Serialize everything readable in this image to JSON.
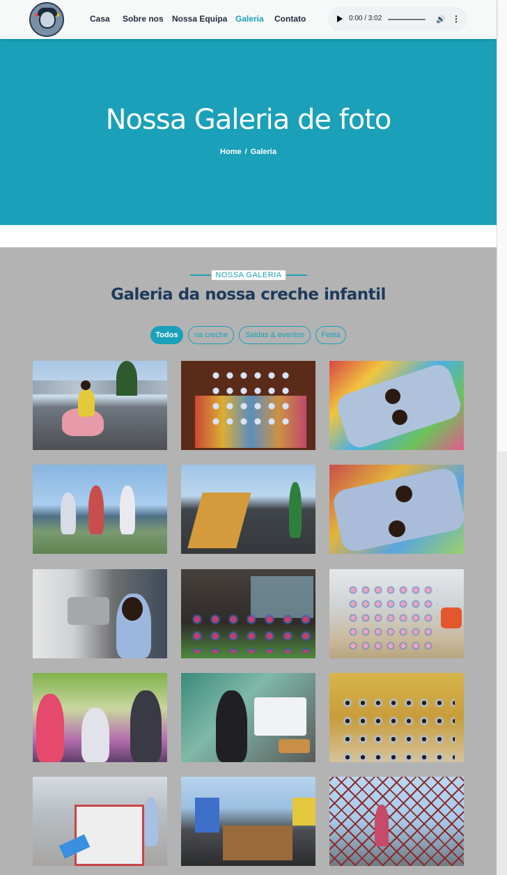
{
  "header": {
    "nav": [
      {
        "label": "Casa",
        "active": false
      },
      {
        "label": "Sobre nos",
        "active": false
      },
      {
        "label": "Nossa Equipa",
        "active": false
      },
      {
        "label": "Galeria",
        "active": true
      },
      {
        "label": "Contato",
        "active": false
      }
    ],
    "audio": {
      "time": "0:00 / 3:02",
      "progress": 0
    }
  },
  "hero": {
    "title": "Nossa Galeria de foto",
    "breadcrumb": {
      "home": "Home",
      "separator": "/",
      "current": "Galeria"
    }
  },
  "gallery": {
    "kicker": "NOSSA GALERIA",
    "title": "Galeria da nossa creche infantil",
    "filters": [
      {
        "label": "Todos",
        "active": true
      },
      {
        "label": "na creche",
        "active": false
      },
      {
        "label": "Saidas & eventos",
        "active": false
      },
      {
        "label": "Festa",
        "active": false
      }
    ]
  },
  "colors": {
    "accent": "#1aa0b8",
    "header_bg": "#f7f8f8",
    "nav_text": "#1d2b3a",
    "title_dark": "#1d3a5a",
    "section_bg": "#b3b3b3"
  }
}
